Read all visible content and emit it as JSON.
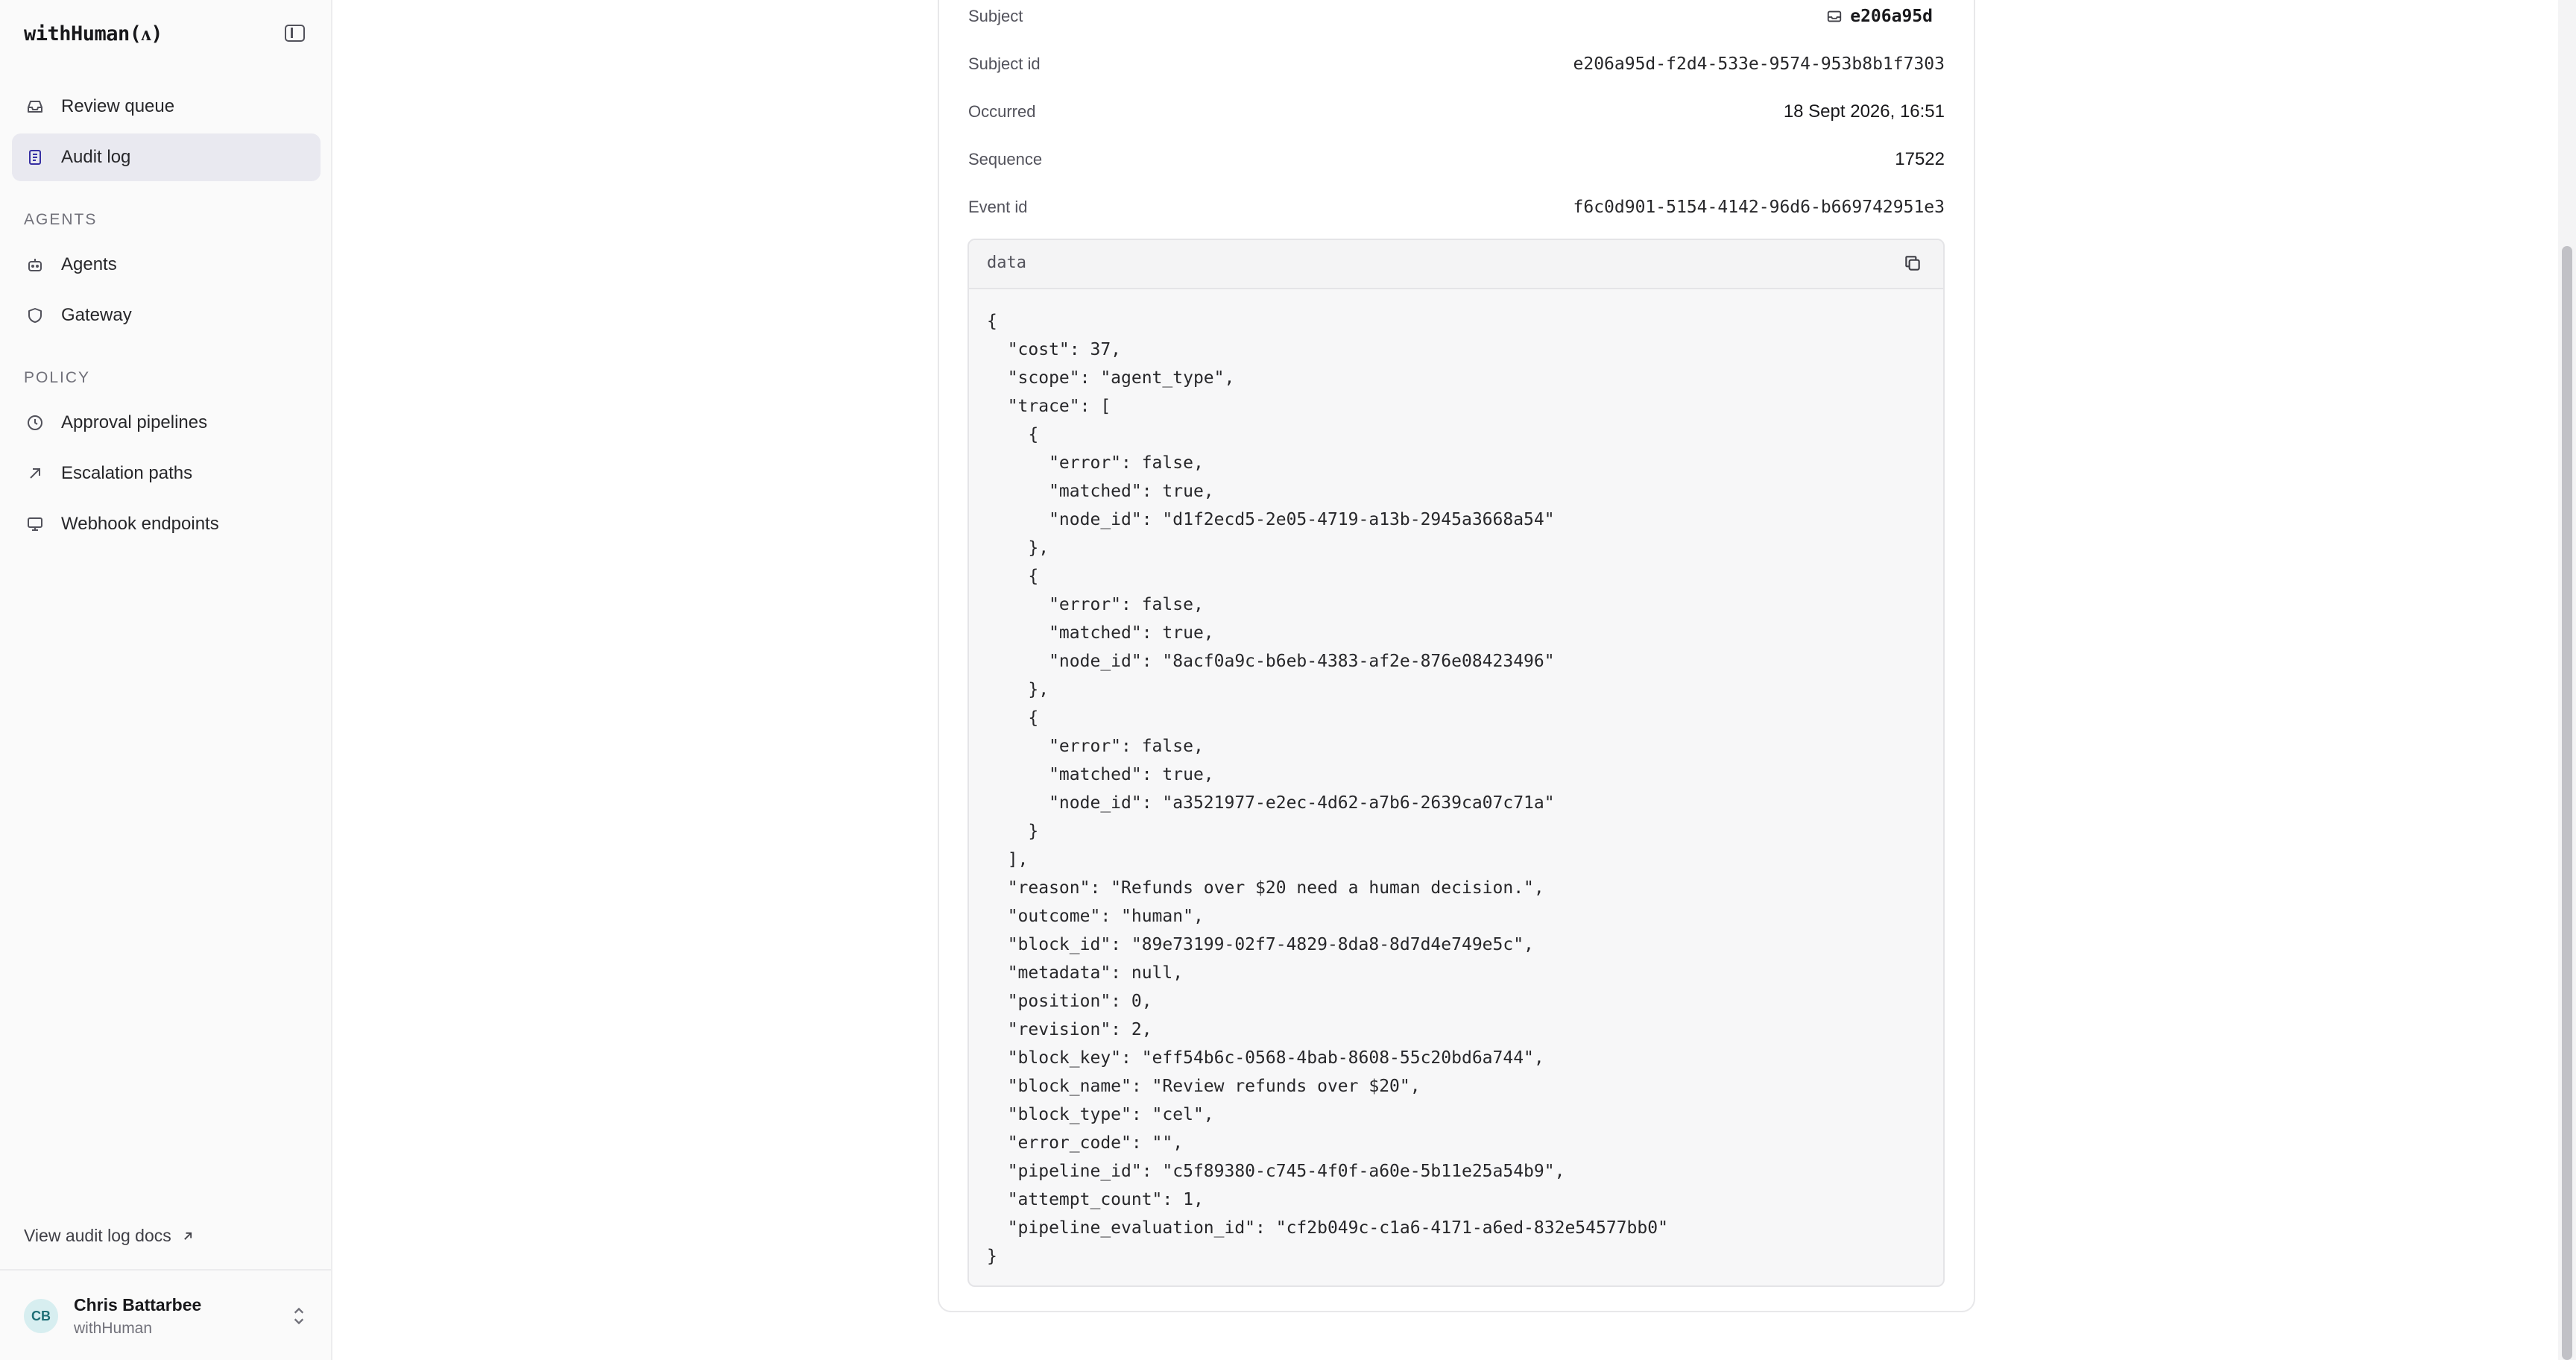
{
  "app": {
    "brand": "withHuman(ᴧ)"
  },
  "sidebar": {
    "primary": [
      {
        "label": "Review queue",
        "icon": "inbox-icon",
        "active": false
      },
      {
        "label": "Audit log",
        "icon": "document-icon",
        "active": true
      }
    ],
    "sections": [
      {
        "title": "AGENTS",
        "items": [
          {
            "label": "Agents",
            "icon": "bot-icon"
          },
          {
            "label": "Gateway",
            "icon": "shield-icon"
          }
        ]
      },
      {
        "title": "POLICY",
        "items": [
          {
            "label": "Approval pipelines",
            "icon": "clock-icon"
          },
          {
            "label": "Escalation paths",
            "icon": "arrow-up-right-icon"
          },
          {
            "label": "Webhook endpoints",
            "icon": "monitor-icon"
          }
        ]
      }
    ],
    "docs_link": "View audit log docs",
    "user": {
      "initials": "CB",
      "name": "Chris Battarbee",
      "org": "withHuman"
    }
  },
  "detail": {
    "fields": [
      {
        "key": "Subject",
        "value": "e206a95d",
        "icon": "mail-icon"
      },
      {
        "key": "Subject id",
        "value": "e206a95d-f2d4-533e-9574-953b8b1f7303"
      },
      {
        "key": "Occurred",
        "value": "18 Sept 2026, 16:51"
      },
      {
        "key": "Sequence",
        "value": "17522"
      },
      {
        "key": "Event id",
        "value": "f6c0d901-5154-4142-96d6-b669742951e3"
      }
    ],
    "data_title": "data",
    "data_json": "{\n  \"cost\": 37,\n  \"scope\": \"agent_type\",\n  \"trace\": [\n    {\n      \"error\": false,\n      \"matched\": true,\n      \"node_id\": \"d1f2ecd5-2e05-4719-a13b-2945a3668a54\"\n    },\n    {\n      \"error\": false,\n      \"matched\": true,\n      \"node_id\": \"8acf0a9c-b6eb-4383-af2e-876e08423496\"\n    },\n    {\n      \"error\": false,\n      \"matched\": true,\n      \"node_id\": \"a3521977-e2ec-4d62-a7b6-2639ca07c71a\"\n    }\n  ],\n  \"reason\": \"Refunds over $20 need a human decision.\",\n  \"outcome\": \"human\",\n  \"block_id\": \"89e73199-02f7-4829-8da8-8d7d4e749e5c\",\n  \"metadata\": null,\n  \"position\": 0,\n  \"revision\": 2,\n  \"block_key\": \"eff54b6c-0568-4bab-8608-55c20bd6a744\",\n  \"block_name\": \"Review refunds over $20\",\n  \"block_type\": \"cel\",\n  \"error_code\": \"\",\n  \"pipeline_id\": \"c5f89380-c745-4f0f-a60e-5b11e25a54b9\",\n  \"attempt_count\": 1,\n  \"pipeline_evaluation_id\": \"cf2b049c-c1a6-4171-a6ed-832e54577bb0\"\n}"
  }
}
